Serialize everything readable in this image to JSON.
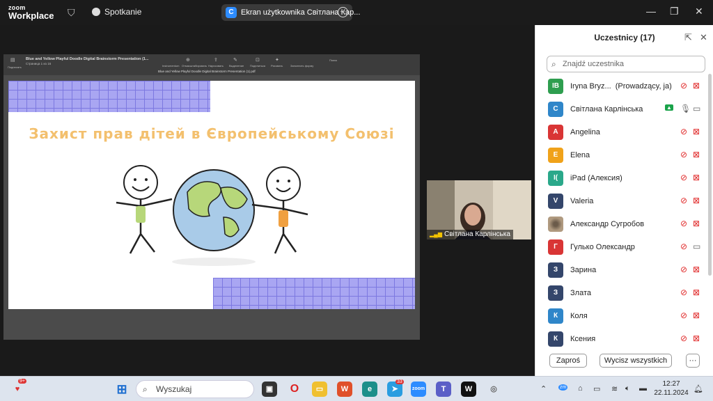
{
  "titlebar": {
    "logo_line1": "zoom",
    "logo_line2": "Workplace",
    "meeting_label": "Spotkanie",
    "share_initial": "C",
    "share_label": "Ekran użytkownika Світлана Кар..."
  },
  "pdf": {
    "title": "Blue and Yellow Playful Doodle Digital Brainstorm Presentation (1...",
    "page_info": "Страница 1 из 16",
    "filename": "Blue and Yellow Playful Doodle Digital Brainstorm Presentation (1).pdf",
    "tools": [
      "Подписать",
      "Instrumentum",
      "Отмасштабировать",
      "Нарисовать",
      "Выделение",
      "Поделиться",
      "Рисовать",
      "Заполнить форму",
      "Поиск"
    ],
    "search_placeholder": "Поиск"
  },
  "slide": {
    "title": "Захист прав дітей в Європейському Союзі",
    "accent_color": "#f3c06e",
    "grid_color": "#a9a6f2"
  },
  "video": {
    "name": "Світлана Карлінська"
  },
  "participants": {
    "header": "Uczestnicy (17)",
    "search_placeholder": "Znajdź uczestnika",
    "invite_label": "Zaproś",
    "mute_all_label": "Wycisz wszystkich",
    "more_label": "···",
    "items": [
      {
        "initials": "IB",
        "name": "Iryna Bryz...",
        "role": "(Prowadzący, ja)",
        "color": "#2e9e4f",
        "mic": "muted",
        "cam": "off"
      },
      {
        "initials": "С",
        "name": "Світлана Карлінська",
        "role": "",
        "color": "#2f86c9",
        "mic": "on",
        "cam": "on"
      },
      {
        "initials": "A",
        "name": "Angelina",
        "role": "",
        "color": "#d93535",
        "mic": "muted",
        "cam": "off"
      },
      {
        "initials": "E",
        "name": "Elena",
        "role": "",
        "color": "#f0a21a",
        "mic": "muted",
        "cam": "off"
      },
      {
        "initials": "I(",
        "name": "iPad (Алексия)",
        "role": "",
        "color": "#2aa88a",
        "mic": "muted",
        "cam": "off"
      },
      {
        "initials": "V",
        "name": "Valeria",
        "role": "",
        "color": "#34466b",
        "mic": "muted",
        "cam": "off"
      },
      {
        "initials": "",
        "name": "Александр Сугробов",
        "role": "",
        "color": "#9a8b7a",
        "mic": "muted",
        "cam": "off"
      },
      {
        "initials": "Г",
        "name": "Гулько Олександр",
        "role": "",
        "color": "#d93535",
        "mic": "muted",
        "cam": "on"
      },
      {
        "initials": "З",
        "name": "Зарина",
        "role": "",
        "color": "#34466b",
        "mic": "muted",
        "cam": "off"
      },
      {
        "initials": "З",
        "name": "Злата",
        "role": "",
        "color": "#34466b",
        "mic": "muted",
        "cam": "off"
      },
      {
        "initials": "К",
        "name": "Коля",
        "role": "",
        "color": "#2f86c9",
        "mic": "muted",
        "cam": "off"
      },
      {
        "initials": "К",
        "name": "Ксения",
        "role": "",
        "color": "#34466b",
        "mic": "muted",
        "cam": "off"
      }
    ]
  },
  "taskbar": {
    "search_placeholder": "Wyszukaj",
    "notif_badge": "9+",
    "mail_badge": "33",
    "time": "12:27",
    "date": "22.11.2024"
  }
}
